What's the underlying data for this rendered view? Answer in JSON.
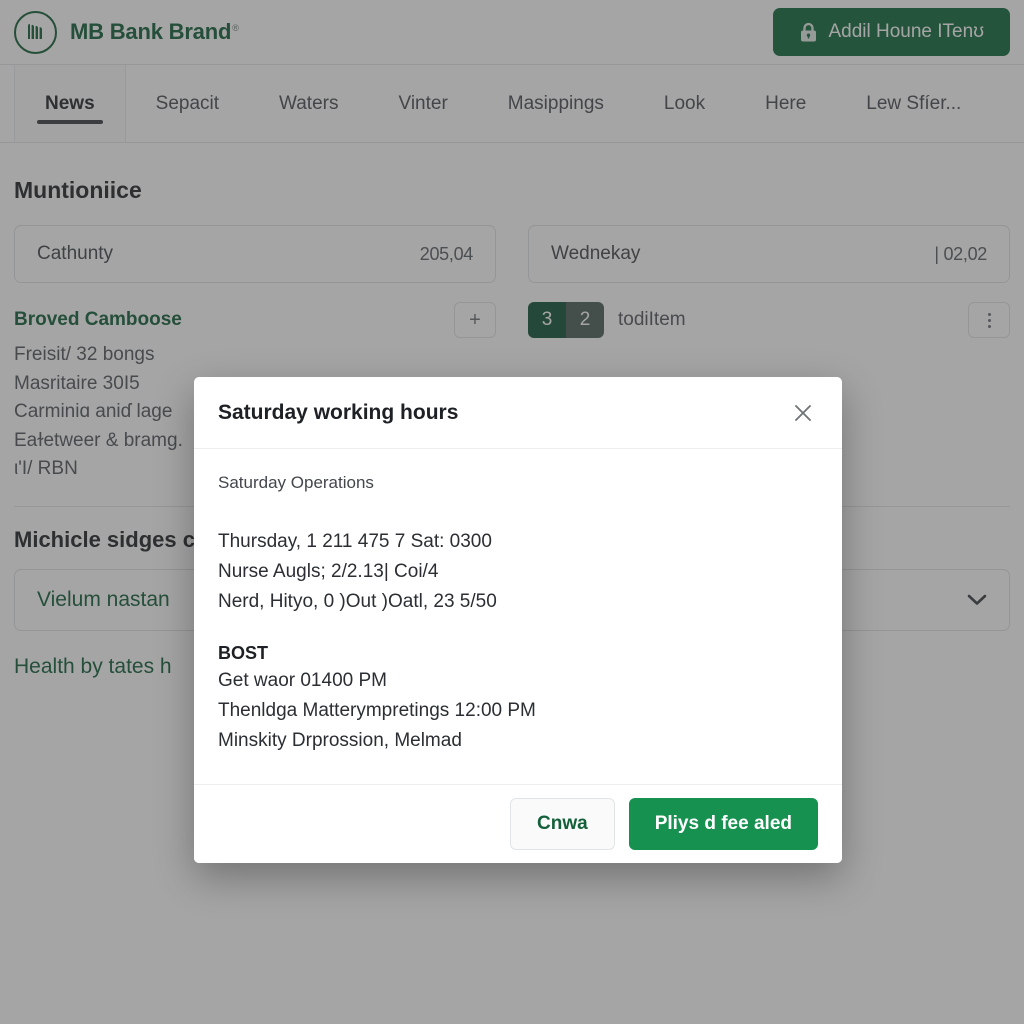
{
  "header": {
    "brand_name": "MB Bank Brand",
    "brand_reg_mark": "®",
    "logo_icon": "bank-circle-logo-icon",
    "cta_label": "Addil Houne ITenʊ",
    "cta_icon": "lock-icon",
    "cta_color": "#13693d"
  },
  "tabs": [
    {
      "label": "News",
      "active": true
    },
    {
      "label": "Sepacit",
      "active": false
    },
    {
      "label": "Waters",
      "active": false
    },
    {
      "label": "Vinter",
      "active": false
    },
    {
      "label": "Masippings",
      "active": false
    },
    {
      "label": "Look",
      "active": false
    },
    {
      "label": "Here",
      "active": false
    },
    {
      "label": "Lew Sfíer...",
      "active": false
    }
  ],
  "main": {
    "section_title": "Muntioniice",
    "left": {
      "field_label": "Cathunty",
      "field_value": "205,04",
      "item_title": "Broved Camboose",
      "add_icon": "plus-icon",
      "add_label": "+",
      "meta_lines": [
        "Freisit/ 32 bongs",
        "Masritaire 30I5",
        "Carminiɑ aniɗ lage",
        "Eaɫetweer & bramg.",
        "ι'I/ RBN"
      ]
    },
    "right": {
      "field_label": "Wednekay",
      "field_value": "| 02,02",
      "badge_primary": "3",
      "badge_secondary": "2",
      "badge_text": "todiItem",
      "menu_icon": "kebab-menu-icon"
    },
    "subsection_title": "Michicle sidges c",
    "select_value": "Vielum nastan",
    "select_chevron_icon": "chevron-down-icon",
    "footer_link": "Health by tates h"
  },
  "modal": {
    "title": "Saturday working hours",
    "close_icon": "close-icon",
    "lead": "Saturday Operations",
    "lines": [
      "Thursday, 1 211 475 7 Sat: 0300",
      "Nurse Augls; 2/2.13| Coi/4",
      "Nerd, Hityo, 0 )Out )Oatl, 23 5/50"
    ],
    "section_heading": "BOST",
    "section_lines": [
      "Get waor 01400 PM",
      "Thenldga Matterympretings 12:00 PM",
      "Minskity Drprossion, Melmad"
    ],
    "cancel_label": "Cnwa",
    "confirm_label": "Pliys d fee aled",
    "confirm_color": "#179150"
  }
}
